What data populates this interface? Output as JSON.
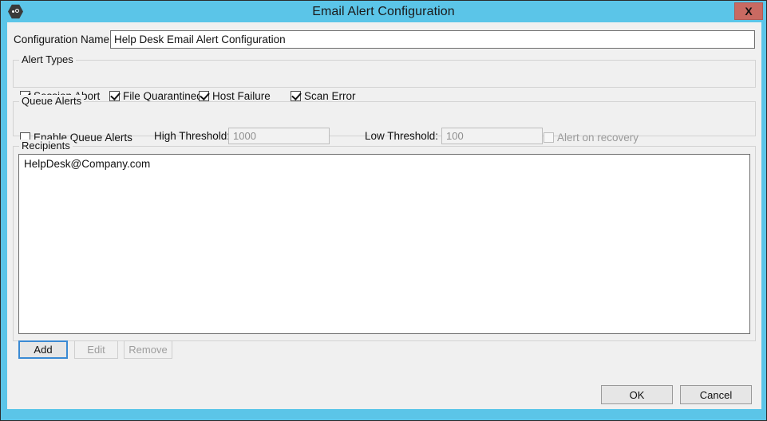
{
  "window": {
    "title": "Email Alert Configuration",
    "icon": "app-hexagon-icon",
    "close_label": "X",
    "accent_color": "#5bc5e8",
    "close_color": "#c96a62",
    "body_color": "#f0f0f0"
  },
  "configuration": {
    "label": "Configuration Name:",
    "value": "Help Desk Email Alert Configuration",
    "placeholder": ""
  },
  "alert_types": {
    "legend": "Alert Types",
    "items": [
      {
        "label": "Session Abort",
        "checked": true
      },
      {
        "label": "File Quarantined",
        "checked": true
      },
      {
        "label": "Host Failure",
        "checked": true
      },
      {
        "label": "Scan Error",
        "checked": true
      }
    ]
  },
  "queue_alerts": {
    "legend": "Queue Alerts",
    "enable": {
      "label": "Enable Queue Alerts",
      "checked": false
    },
    "high_threshold": {
      "label": "High Threshold:",
      "value": "1000",
      "enabled": false
    },
    "low_threshold": {
      "label": "Low Threshold:",
      "value": "100",
      "enabled": false
    },
    "alert_on_recovery": {
      "label": "Alert on recovery",
      "checked": false,
      "enabled": false
    }
  },
  "recipients": {
    "legend": "Recipients",
    "items": [
      "HelpDesk@Company.com"
    ],
    "buttons": {
      "add": "Add",
      "edit": "Edit",
      "remove": "Remove"
    }
  },
  "footer": {
    "ok": "OK",
    "cancel": "Cancel"
  }
}
